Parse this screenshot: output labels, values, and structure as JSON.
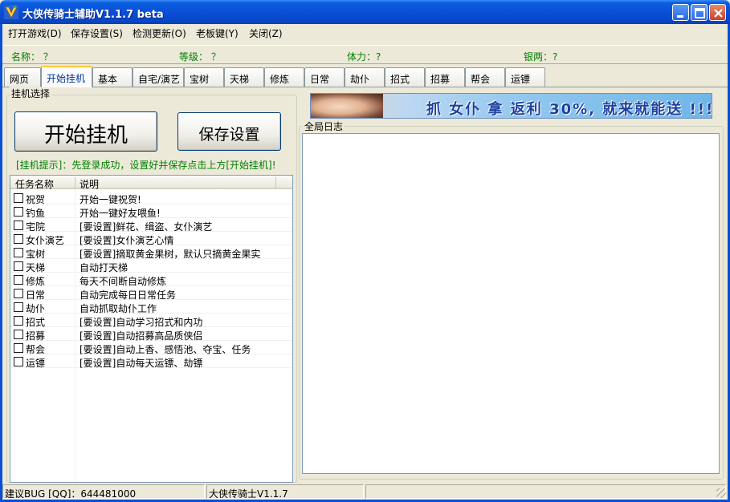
{
  "window": {
    "title": "大侠传骑士辅助V1.1.7 beta",
    "icon": "app-logo-icon"
  },
  "menu": {
    "items": [
      "打开游戏(D)",
      "保存设置(S)",
      "检测更新(O)",
      "老板键(Y)",
      "关闭(Z)"
    ]
  },
  "info": {
    "name": "名称： ？",
    "level": "等级： ？",
    "stamina": "体力：?",
    "silver": "银两：?"
  },
  "tabs": [
    {
      "label": "网页",
      "active": false
    },
    {
      "label": "开始挂机",
      "active": true
    },
    {
      "label": "基本",
      "active": false
    },
    {
      "label": "自宅/演艺",
      "active": false
    },
    {
      "label": "宝树",
      "active": false
    },
    {
      "label": "天梯",
      "active": false
    },
    {
      "label": "修炼",
      "active": false
    },
    {
      "label": "日常",
      "active": false
    },
    {
      "label": "劫仆",
      "active": false
    },
    {
      "label": "招式",
      "active": false
    },
    {
      "label": "招募",
      "active": false
    },
    {
      "label": "帮会",
      "active": false
    },
    {
      "label": "运镖",
      "active": false
    }
  ],
  "main": {
    "group_label": "挂机选择",
    "start_label": "开始挂机",
    "save_label": "保存设置",
    "hint": "[挂机提示]：先登录成功，设置好并保存点击上方[开始挂机]!",
    "columns": [
      "任务名称",
      "说明"
    ],
    "tasks": [
      {
        "name": "祝贺",
        "desc": "开始一键祝贺!"
      },
      {
        "name": "钓鱼",
        "desc": "开始一键好友喂鱼!"
      },
      {
        "name": "宅院",
        "desc": "[要设置]鲜花、缉盗、女仆演艺"
      },
      {
        "name": "女仆演艺",
        "desc": "[要设置]女仆演艺心情"
      },
      {
        "name": "宝树",
        "desc": "[要设置]摘取黄金果树，默认只摘黄金果实"
      },
      {
        "name": "天梯",
        "desc": "自动打天梯"
      },
      {
        "name": "修炼",
        "desc": "每天不间断自动修炼"
      },
      {
        "name": "日常",
        "desc": "自动完成每日日常任务"
      },
      {
        "name": "劫仆",
        "desc": "自动抓取劫仆工作"
      },
      {
        "name": "招式",
        "desc": "[要设置]自动学习招式和内功"
      },
      {
        "name": "招募",
        "desc": "[要设置]自动招募高品质侠侣"
      },
      {
        "name": "帮会",
        "desc": "[要设置]自动上香、感悟池、夺宝、任务"
      },
      {
        "name": "运镖",
        "desc": "[要设置]自动每天运镖、劫镖"
      }
    ]
  },
  "banner": {
    "text": "抓 女仆 拿 返利 30%, 就来就能送 !!!"
  },
  "log": {
    "label": "全局日志"
  },
  "status": {
    "left": "建议BUG [QQ]：644481000",
    "middle": "大侠传骑士V1.1.7",
    "right": ""
  }
}
